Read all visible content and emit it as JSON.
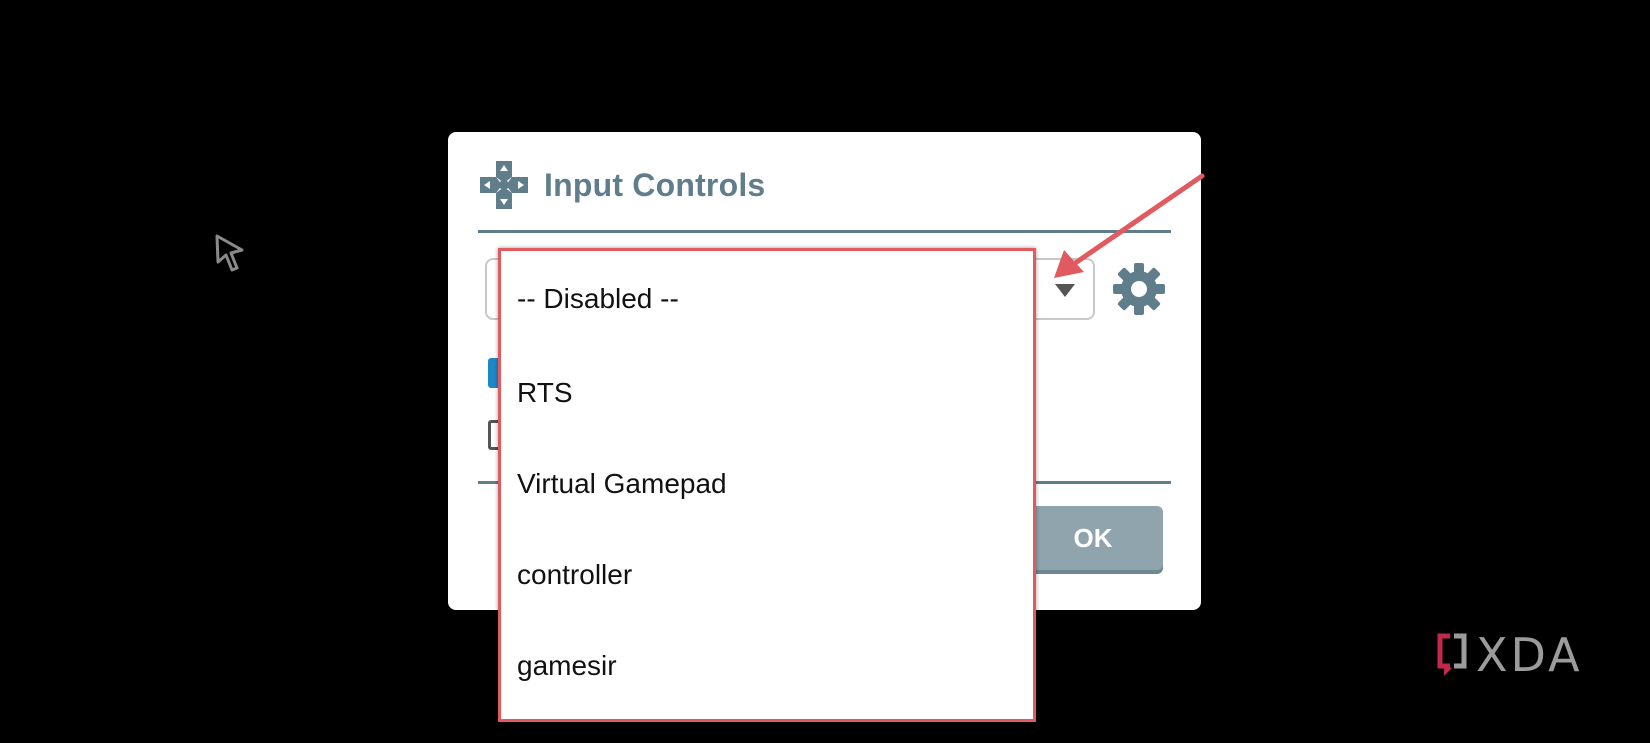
{
  "dialog": {
    "icon": "dpad-icon",
    "title": "Input Controls",
    "settings_icon": "gear-icon",
    "ok_label": "OK"
  },
  "dropdown": {
    "options": [
      "-- Disabled --",
      "RTS",
      "Virtual Gamepad",
      "controller",
      "gamesir"
    ],
    "highlight_color": "#e05a5f"
  },
  "checkboxes": [
    {
      "checked": true
    },
    {
      "checked": false
    }
  ],
  "watermark": {
    "icon": "xda-bracket-icon",
    "text": "XDA"
  },
  "colors": {
    "background": "#000000",
    "accent": "#607d8b",
    "checkbox": "#1e88c7",
    "annotation": "#e05a5f"
  }
}
